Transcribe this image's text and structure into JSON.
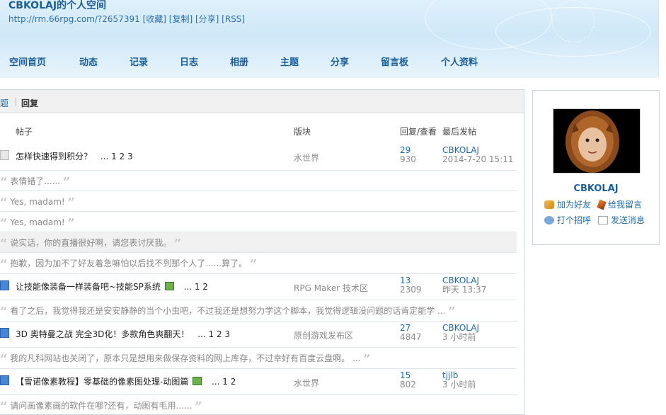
{
  "header": {
    "title": "CBKOLAJ的个人空间",
    "url": "http://rm.66rpg.com/?2657391",
    "links": [
      "[收藏]",
      "[复制]",
      "[分享]",
      "[RSS]"
    ]
  },
  "nav": [
    "空间首页",
    "动态",
    "记录",
    "日志",
    "相册",
    "主题",
    "分享",
    "留言板",
    "个人资料"
  ],
  "tabs": {
    "topic": "主题",
    "reply": "回复"
  },
  "columns": {
    "post": "帖子",
    "forum": "版块",
    "replies_views": "回复/查看",
    "last_post": "最后发帖"
  },
  "threads": [
    {
      "title": "怎样快速得到积分？",
      "pages": "... 1 2 3",
      "forum": "水世界",
      "replies": "29",
      "views": "930",
      "last_user": "CBKOLAJ",
      "last_time": "2014-7-20 15:11"
    },
    {
      "title": "让技能像装备一样装备吧~技能SP系统",
      "pages": "... 1 2",
      "forum": "RPG Maker 技术区",
      "replies": "13",
      "views": "2309",
      "last_user": "CBKOLAJ",
      "last_time": "昨天 13:37"
    },
    {
      "title": "3D 奥特曼之战 完全3D化！多款角色爽翻天！",
      "pages": "... 1 2 3",
      "forum": "原创游戏发布区",
      "replies": "27",
      "views": "4847",
      "last_user": "CBKOLAJ",
      "last_time": "3 小时前"
    },
    {
      "title": "【雪诺像素教程】零基础的像素图处理-动图篇",
      "pages": "... 1 2",
      "forum": "水世界",
      "replies": "15",
      "views": "802",
      "last_user": "tjjlb",
      "last_time": "3 小时前"
    }
  ],
  "quotes": [
    "表情错了......",
    "Yes, madam!",
    "Yes, madam!",
    "说实话，你的直播很好啊，请您表讨厌我。",
    "抱歉，因为加不了好友着急嘛怕以后找不到那个人了......算了。",
    "看了之后，我觉得我还是安安静静的当个小虫吧，不过我还是想努力学这个脚本，我觉得逻辑没问题的话肯定能学 ...",
    "我的凡科网站也关闭了，原本只是想用来做保存资料的网上库存，不过幸好有百度云盘啊。 ...",
    "请问画像素画的软件在哪?还有，动图有毛用......"
  ],
  "sidebar": {
    "username": "CBKOLAJ",
    "add_friend": "加为好友",
    "leave_message": "给我留言",
    "greet": "打个招呼",
    "send_message": "发送消息"
  }
}
